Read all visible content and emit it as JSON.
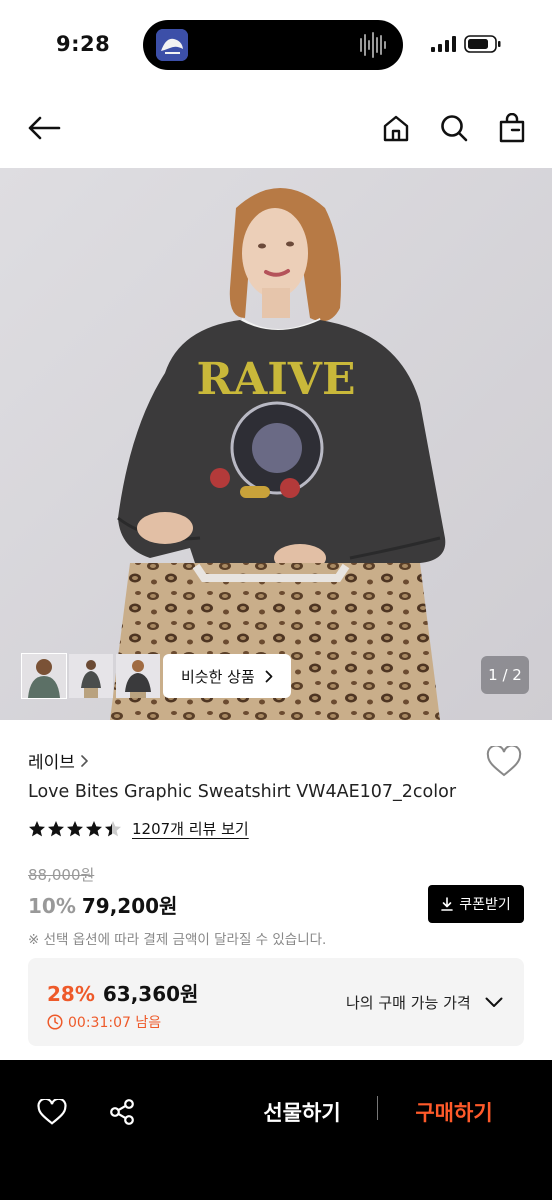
{
  "status": {
    "time": "9:28"
  },
  "nav": {
    "back_icon": "arrow-left-icon",
    "home_icon": "home-icon",
    "search_icon": "search-icon",
    "bag_icon": "shopping-bag-icon"
  },
  "gallery": {
    "graphic_text": "RAIVE",
    "similar_label": "비슷한 상품",
    "page_indicator": "1 / 2"
  },
  "product": {
    "brand": "레이브",
    "title": "Love Bites Graphic Sweatshirt VW4AE107_2color",
    "rating": 4.5,
    "review_link": "1207개 리뷰 보기",
    "original_price": "88,000원",
    "discount": "10%",
    "price": "79,200원",
    "coupon_label": "쿠폰받기",
    "option_note": "※ 선택 옵션에 따라 결제 금액이 달라질 수 있습니다."
  },
  "my_price": {
    "discount": "28%",
    "price": "63,360원",
    "timer": "00:31:07 남음",
    "label": "나의 구매 가능 가격"
  },
  "bottom": {
    "gift_label": "선물하기",
    "buy_label": "구매하기"
  },
  "colors": {
    "accent": "#ee5a2a",
    "buy": "#ff5a2a",
    "black": "#000000"
  }
}
